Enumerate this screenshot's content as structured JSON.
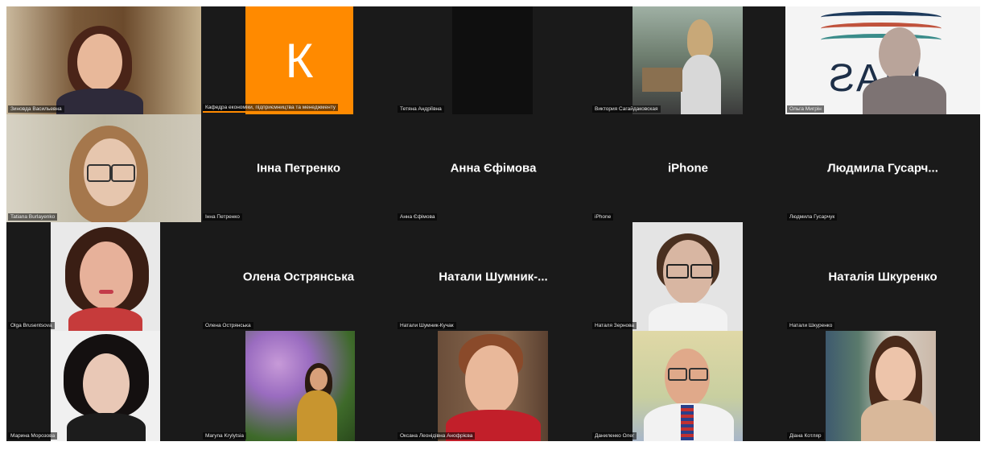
{
  "meeting": {
    "participants": [
      {
        "id": "p1",
        "label": "Зиновда Васильевна"
      },
      {
        "id": "p2",
        "label": "Кафедра економіки, підприємництва та менеджменту",
        "avatar_letter": "К"
      },
      {
        "id": "p3",
        "label": "Тетяна Андріївна"
      },
      {
        "id": "p4",
        "label": "Виктория Сагайдаковская"
      },
      {
        "id": "p5",
        "label": "Ольга Мигрін"
      },
      {
        "id": "p6",
        "label": "Tatiana Burlayenko"
      },
      {
        "id": "p7",
        "label": "Інна Петренко",
        "display_name": "Інна Петренко"
      },
      {
        "id": "p8",
        "label": "Анна Єфімова",
        "display_name": "Анна Єфімова"
      },
      {
        "id": "p9",
        "label": "iPhone",
        "display_name": "iPhone"
      },
      {
        "id": "p10",
        "label": "Людмила Гусарчук",
        "display_name": "Людмила  Гусарч..."
      },
      {
        "id": "p11",
        "label": "Olga Brusentsova"
      },
      {
        "id": "p12",
        "label": "Олена Острянська",
        "display_name": "Олена Острянська"
      },
      {
        "id": "p13",
        "label": "Натали Шумник-Кучак",
        "display_name": "Натали  Шумник-..."
      },
      {
        "id": "p14",
        "label": "Наталя Зернова"
      },
      {
        "id": "p15",
        "label": "Натали Шкуренко",
        "display_name": "Наталія Шкуренко"
      },
      {
        "id": "p16",
        "label": "Марина Морозова"
      },
      {
        "id": "p17",
        "label": "Maryna Krylytsia"
      },
      {
        "id": "p18",
        "label": "Оксана Леонідівна Анофрієва"
      },
      {
        "id": "p19",
        "label": "Даниленко Олег"
      },
      {
        "id": "p20",
        "label": "Діана Котляр"
      }
    ],
    "logo_text": "KIAS",
    "colors": {
      "tile_bg": "#1a1a1a",
      "accent_orange": "#ff8a00"
    }
  }
}
